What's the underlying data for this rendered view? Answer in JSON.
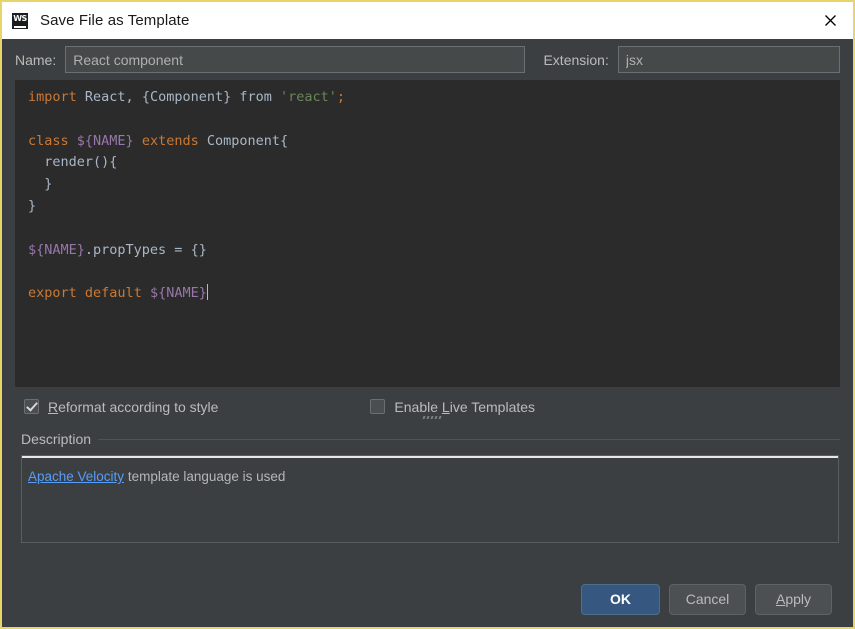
{
  "window": {
    "title": "Save File as Template",
    "app_icon": "webstorm-icon",
    "icon_text": "WS",
    "close_icon": "close-icon",
    "border_color": "#e8d468",
    "background": "#3c3f41"
  },
  "name_row": {
    "name_label": "Name:",
    "name_value": "React component",
    "extension_label": "Extension:",
    "extension_value": "jsx"
  },
  "editor": {
    "background": "#2b2b2b",
    "colors": {
      "keyword": "#cc7832",
      "string": "#6a8759",
      "variable": "#9876aa",
      "plain": "#a9b7c6"
    },
    "lines": [
      {
        "tokens": [
          {
            "t": "import",
            "c": "kw"
          },
          {
            "t": " React, ",
            "c": "pln"
          },
          {
            "t": "{Component}",
            "c": "pln"
          },
          {
            "t": " ",
            "c": "pln"
          },
          {
            "t": "from",
            "c": "pln"
          },
          {
            "t": " ",
            "c": "pln"
          },
          {
            "t": "'react'",
            "c": "str"
          },
          {
            "t": ";",
            "c": "kw"
          }
        ]
      },
      {
        "tokens": []
      },
      {
        "tokens": [
          {
            "t": "class",
            "c": "kw"
          },
          {
            "t": " ",
            "c": "pln"
          },
          {
            "t": "${NAME}",
            "c": "var"
          },
          {
            "t": " ",
            "c": "pln"
          },
          {
            "t": "extends",
            "c": "kw"
          },
          {
            "t": " Component{",
            "c": "pln"
          }
        ]
      },
      {
        "tokens": [
          {
            "t": "  render(){",
            "c": "pln"
          }
        ]
      },
      {
        "tokens": [
          {
            "t": "  }",
            "c": "pln"
          }
        ]
      },
      {
        "tokens": [
          {
            "t": "}",
            "c": "pln"
          }
        ]
      },
      {
        "tokens": []
      },
      {
        "tokens": [
          {
            "t": "${NAME}",
            "c": "var"
          },
          {
            "t": ".propTypes = {}",
            "c": "pln"
          }
        ]
      },
      {
        "tokens": []
      },
      {
        "tokens": [
          {
            "t": "export",
            "c": "kw"
          },
          {
            "t": " ",
            "c": "pln"
          },
          {
            "t": "default",
            "c": "kw"
          },
          {
            "t": " ",
            "c": "pln"
          },
          {
            "t": "${NAME}",
            "c": "var"
          }
        ],
        "caret": true
      }
    ],
    "plain_text": "import React, {Component} from 'react';\n\nclass ${NAME} extends Component{\n  render(){\n  }\n}\n\n${NAME}.propTypes = {}\n\nexport default ${NAME}"
  },
  "options": {
    "reformat": {
      "label_before": "R",
      "label_after": "eformat according to style",
      "checked": true
    },
    "live_templates": {
      "label_before": "Enable ",
      "mnemonic": "L",
      "label_after": "ive Templates",
      "checked": false
    },
    "resize_grip": "resize-grip"
  },
  "description": {
    "title": "Description",
    "link_text": "Apache Velocity",
    "rest_text": " template language is used"
  },
  "buttons": {
    "ok": "OK",
    "cancel": "Cancel",
    "apply_mnemonic": "A",
    "apply_rest": "pply",
    "ok_color": "#365880"
  }
}
